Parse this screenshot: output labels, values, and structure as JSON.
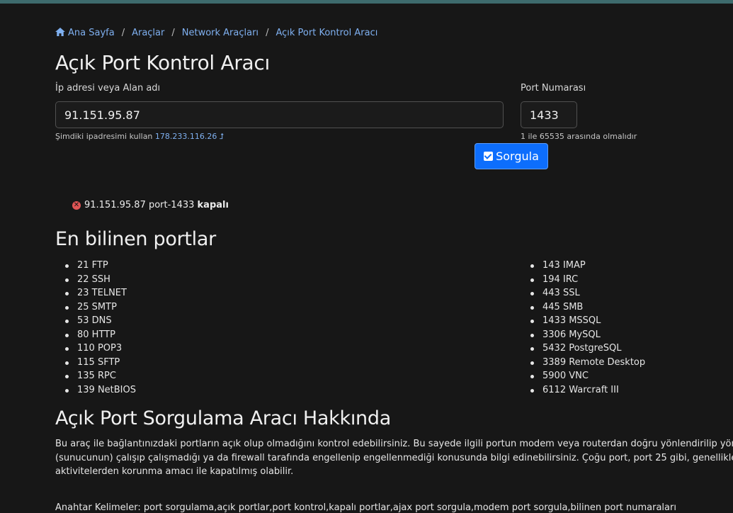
{
  "breadcrumb": {
    "items": [
      "Ana Sayfa",
      "Araçlar",
      "Network Araçları",
      "Açık Port Kontrol Aracı"
    ],
    "separator": "/"
  },
  "page_title": "Açık Port Kontrol Aracı",
  "form": {
    "ip_label": "İp adresi veya Alan adı",
    "ip_value": "91.151.95.87",
    "ip_hint_prefix": "Şimdiki ipadresimi kullan",
    "ip_hint_link": "178.233.116.26",
    "port_label": "Port Numarası",
    "port_value": "1433",
    "port_hint": "1 ile 65535 arasında olmalıdır",
    "submit_label": "Sorgula"
  },
  "result": {
    "text": "91.151.95.87 port-1433",
    "status": "kapalı"
  },
  "ports_section": {
    "title": "En bilinen portlar",
    "left": [
      "21 FTP",
      "22 SSH",
      "23 TELNET",
      "25 SMTP",
      "53 DNS",
      "80 HTTP",
      "110 POP3",
      "115 SFTP",
      "135 RPC",
      "139 NetBIOS"
    ],
    "right": [
      "143 IMAP",
      "194 IRC",
      "443 SSL",
      "445 SMB",
      "1433 MSSQL",
      "3306 MySQL",
      "5432 PostgreSQL",
      "3389 Remote Desktop",
      "5900 VNC",
      "6112 Warcraft III"
    ]
  },
  "about": {
    "title": "Açık Port Sorgulama Aracı Hakkında",
    "body": "Bu araç ile bağlantınızdaki portların açık olup olmadığını kontrol edebilirsiniz. Bu sayede ilgili portun modem veya routerdan doğru yönlendirilip yönle\n(sunucunun) çalışıp çalışmadığı ya da firewall tarafında engellenip engellenmediği konusunda bilgi edinebilirsiniz. Çoğu port, port 25 gibi, genellikle\naktivitelerden korunma amacı ile kapatılmış olabilir.",
    "keywords": "Anahtar Kelimeler: port sorgulama,açık portlar,port kontrol,kapalı portlar,ajax port sorgula,modem port sorgula,bilinen port numaraları"
  },
  "colors": {
    "background": "#171717",
    "link": "#7fb0f0",
    "primary": "#0d6efd",
    "error": "#e05555"
  }
}
